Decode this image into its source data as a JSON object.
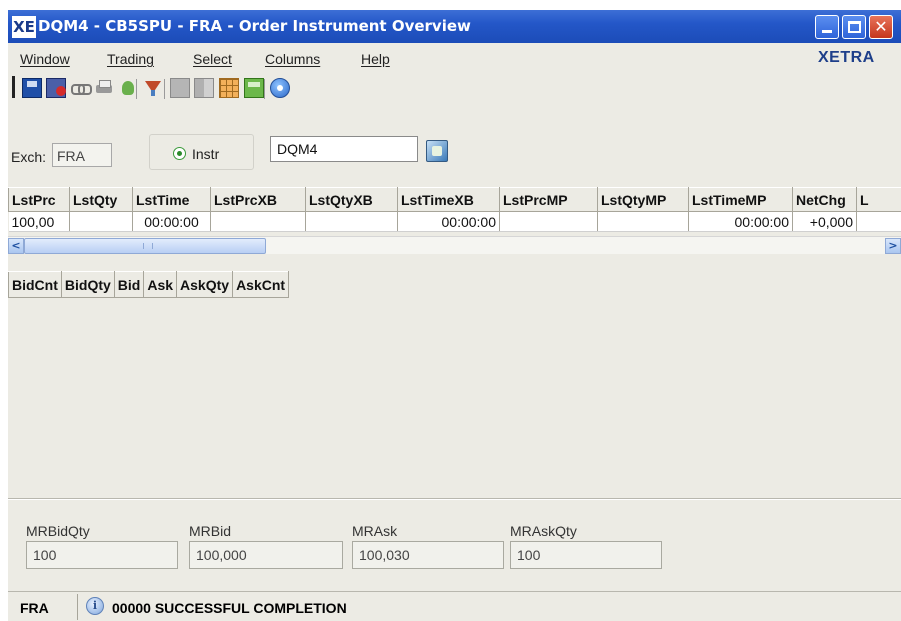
{
  "window": {
    "logo": "XE",
    "title": "DQM4 - CB5SPU - FRA - Order Instrument Overview"
  },
  "menu": {
    "window": "Window",
    "trading": "Trading",
    "select": "Select",
    "columns": "Columns",
    "help": "Help",
    "brand": "XETRA"
  },
  "toolbar": {
    "icons": [
      "save-icon",
      "save-as-icon",
      "link-icon",
      "print-icon",
      "export-icon",
      "filter-icon",
      "table-icon",
      "columns-icon",
      "grid-icon",
      "chart-icon",
      "help-icon"
    ]
  },
  "instrument": {
    "exch_label": "Exch:",
    "exch_value": "FRA",
    "radio_label": "Instr",
    "instr_value": "DQM4"
  },
  "table1": {
    "columns": [
      "LstPrc",
      "LstQty",
      "LstTime",
      "LstPrcXB",
      "LstQtyXB",
      "LstTimeXB",
      "LstPrcMP",
      "LstQtyMP",
      "LstTimeMP",
      "NetChg",
      "L"
    ],
    "row": [
      "100,00",
      "",
      "00:00:00",
      "",
      "",
      "00:00:00",
      "",
      "",
      "00:00:00",
      "+0,000",
      ""
    ]
  },
  "table2": {
    "columns": [
      "BidCnt",
      "BidQty",
      "Bid",
      "Ask",
      "AskQty",
      "AskCnt"
    ]
  },
  "market": {
    "mrbidqty_label": "MRBidQty",
    "mrbidqty_value": "100",
    "mrbid_label": "MRBid",
    "mrbid_value": "100,000",
    "mrask_label": "MRAsk",
    "mrask_value": "100,030",
    "mraskqty_label": "MRAskQty",
    "mraskqty_value": "100"
  },
  "status": {
    "exchange": "FRA",
    "icon": "info-icon",
    "message": "00000 SUCCESSFUL COMPLETION"
  },
  "colors": {
    "titlebar": "#2457c8",
    "brand": "#1e3f8a",
    "background": "#ecebe4"
  }
}
